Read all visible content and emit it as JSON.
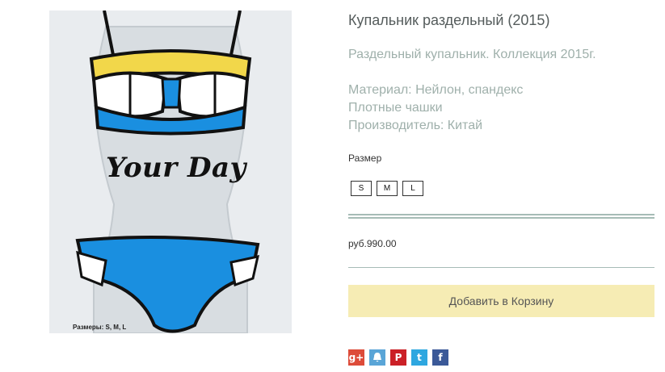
{
  "product": {
    "title": "Купальник раздельный (2015)",
    "description_lines": [
      "Раздельный купальник. Коллекция 2015г.",
      "Материал: Нейлон, спандекс",
      "Плотные чашки",
      "Производитель: Китай"
    ],
    "image": {
      "overlay_text": "Your Day",
      "caption": "Размеры: S, M, L"
    }
  },
  "size_selector": {
    "label": "Размер",
    "options": [
      "S",
      "M",
      "L"
    ]
  },
  "price": "руб.990.00",
  "cart": {
    "add_label": "Добавить в Корзину"
  },
  "share": [
    {
      "name": "google-plus",
      "glyph": "g+",
      "color": "#dd4b39"
    },
    {
      "name": "vk",
      "glyph": "🔔",
      "color": "#5aa5d7"
    },
    {
      "name": "pinterest",
      "glyph": "P",
      "color": "#cb2027"
    },
    {
      "name": "twitter",
      "glyph": "t",
      "color": "#2ea7e0"
    },
    {
      "name": "facebook",
      "glyph": "f",
      "color": "#3b5998"
    }
  ],
  "colors": {
    "accent_line": "#a6bcb6",
    "cart_button": "#f6ecb4",
    "swimsuit_blue": "#1a8fe0",
    "swimsuit_yellow": "#f2d74a"
  }
}
